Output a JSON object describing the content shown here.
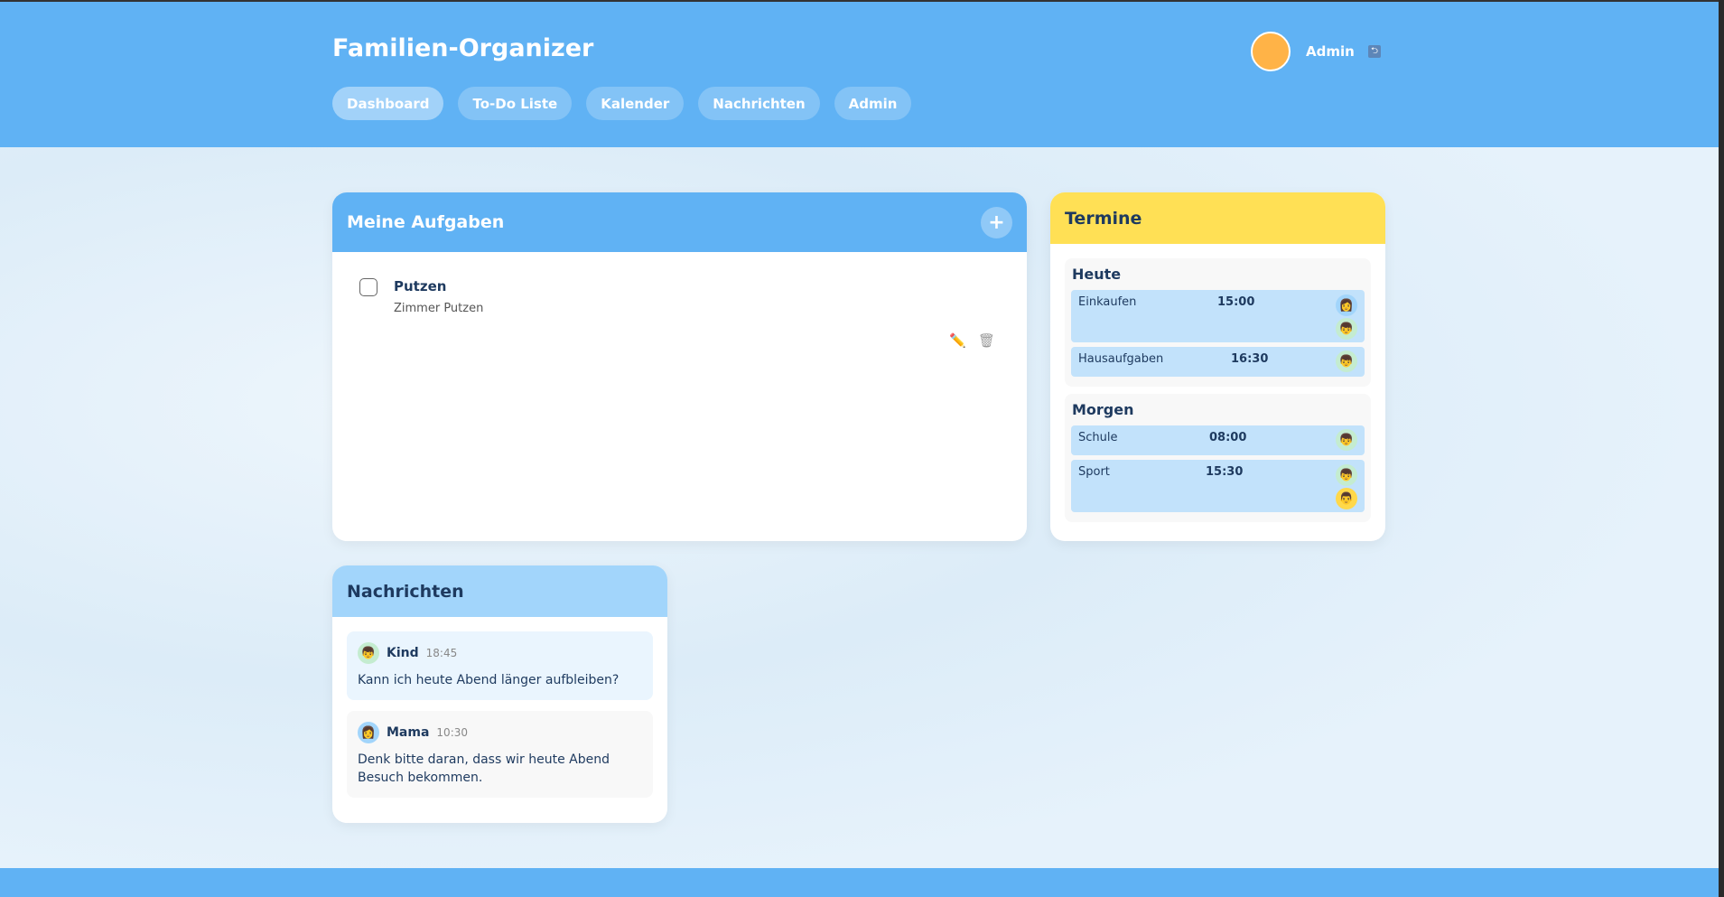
{
  "header": {
    "title": "Familien-Organizer",
    "nav": [
      "Dashboard",
      "To-Do Liste",
      "Kalender",
      "Nachrichten",
      "Admin"
    ],
    "active": "Dashboard",
    "user": "Admin",
    "avatar_color": "#ffb347",
    "logout_icon": "logout-icon"
  },
  "tasks": {
    "title": "Meine Aufgaben",
    "add_label": "+",
    "items": [
      {
        "name": "Putzen",
        "description": "Zimmer Putzen",
        "done": false
      }
    ]
  },
  "termine": {
    "title": "Termine",
    "groups": [
      {
        "label": "Heute",
        "events": [
          {
            "name": "Einkaufen",
            "time": "15:00",
            "people": [
              "mama",
              "kind"
            ]
          },
          {
            "name": "Hausaufgaben",
            "time": "16:30",
            "people": [
              "kind"
            ]
          }
        ]
      },
      {
        "label": "Morgen",
        "events": [
          {
            "name": "Schule",
            "time": "08:00",
            "people": [
              "kind"
            ]
          },
          {
            "name": "Sport",
            "time": "15:30",
            "people": [
              "kind",
              "papa"
            ]
          }
        ]
      }
    ]
  },
  "messages": {
    "title": "Nachrichten",
    "items": [
      {
        "sender": "Kind",
        "time": "18:45",
        "text": "Kann ich heute Abend länger aufbleiben?"
      },
      {
        "sender": "Mama",
        "time": "10:30",
        "text": "Denk bitte daran, dass wir heute Abend Besuch bekommen."
      }
    ]
  },
  "colors": {
    "primary": "#60b2f4",
    "termine_header": "#ffe055",
    "messages_header": "#a2d5fb",
    "event_bg": "#c2e2fb"
  }
}
